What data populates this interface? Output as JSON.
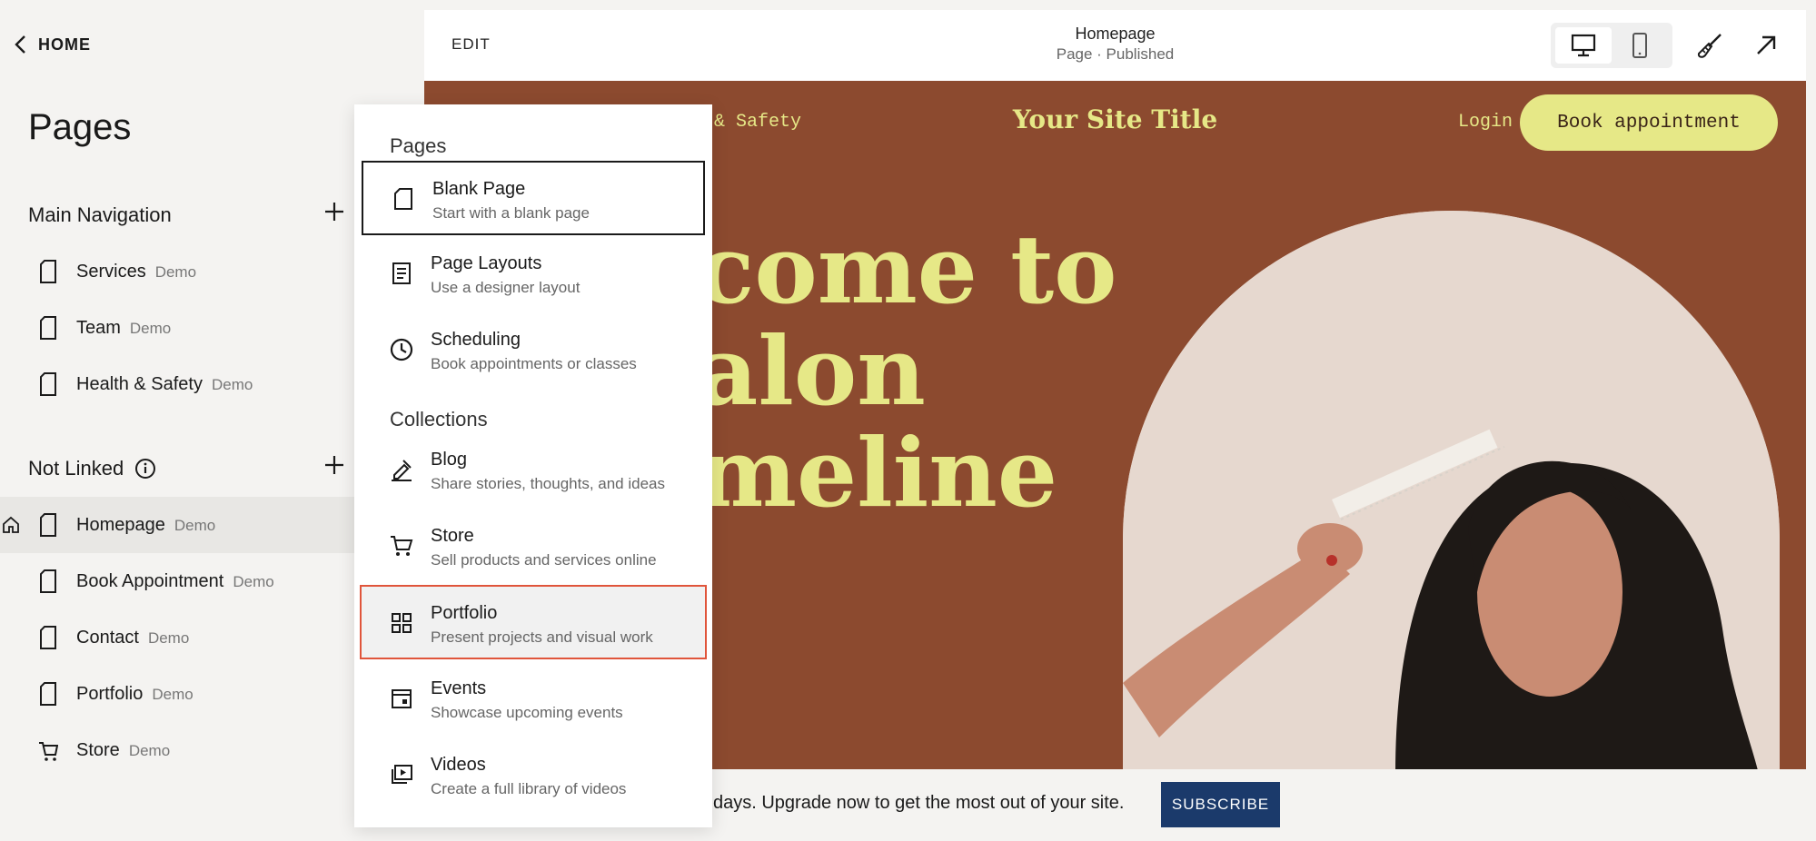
{
  "sidebar": {
    "home_label": "HOME",
    "title": "Pages",
    "main_nav_label": "Main Navigation",
    "not_linked_label": "Not Linked",
    "main_items": [
      {
        "label": "Services",
        "badge": "Demo"
      },
      {
        "label": "Team",
        "badge": "Demo"
      },
      {
        "label": "Health & Safety",
        "badge": "Demo"
      }
    ],
    "not_linked_items": [
      {
        "label": "Homepage",
        "badge": "Demo"
      },
      {
        "label": "Book Appointment",
        "badge": "Demo"
      },
      {
        "label": "Contact",
        "badge": "Demo"
      },
      {
        "label": "Portfolio",
        "badge": "Demo"
      },
      {
        "label": "Store",
        "badge": "Demo"
      }
    ]
  },
  "toolbar": {
    "edit_label": "EDIT",
    "page_title": "Homepage",
    "page_status": "Page · Published"
  },
  "site": {
    "nav_left": "h & Safety",
    "title": "Your Site Title",
    "login": "Login",
    "book_button": "Book appointment",
    "hero_lines": [
      "come to",
      "alon",
      "meline"
    ]
  },
  "banner": {
    "text": "days. Upgrade now to get the most out of your site.",
    "subscribe": "SUBSCRIBE"
  },
  "dropdown": {
    "pages_header": "Pages",
    "collections_header": "Collections",
    "items": [
      {
        "name": "Blank Page",
        "desc": "Start with a blank page",
        "icon": "page-icon"
      },
      {
        "name": "Page Layouts",
        "desc": "Use a designer layout",
        "icon": "layout-icon"
      },
      {
        "name": "Scheduling",
        "desc": "Book appointments or classes",
        "icon": "clock-icon"
      },
      {
        "name": "Blog",
        "desc": "Share stories, thoughts, and ideas",
        "icon": "pen-icon"
      },
      {
        "name": "Store",
        "desc": "Sell products and services online",
        "icon": "cart-icon"
      },
      {
        "name": "Portfolio",
        "desc": "Present projects and visual work",
        "icon": "grid-icon"
      },
      {
        "name": "Events",
        "desc": "Showcase upcoming events",
        "icon": "calendar-icon"
      },
      {
        "name": "Videos",
        "desc": "Create a full library of videos",
        "icon": "video-icon"
      }
    ]
  },
  "colors": {
    "site_background": "#8c4a2f",
    "site_accent": "#e6e887",
    "subscribe_button": "#1b3a6b",
    "highlight_border": "#e0553b"
  }
}
